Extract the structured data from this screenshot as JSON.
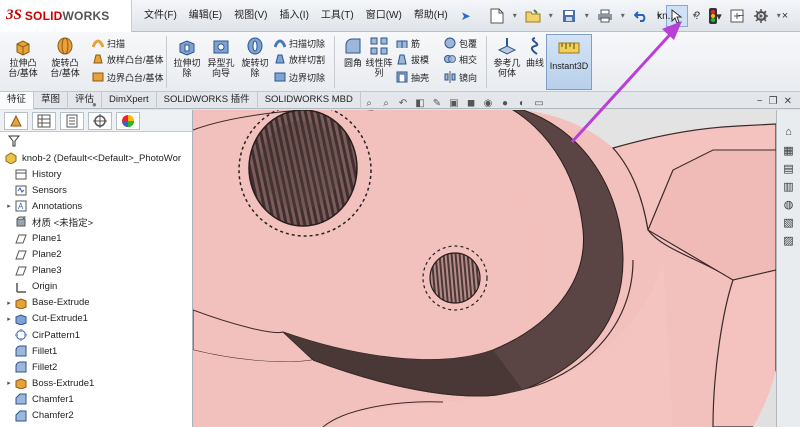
{
  "app": {
    "logo_ds": "3S",
    "logo_solid": "SOLID",
    "logo_works": "WORKS",
    "document_name": "kn..."
  },
  "menu": [
    "文件(F)",
    "编辑(E)",
    "视图(V)",
    "插入(I)",
    "工具(T)",
    "窗口(W)",
    "帮助(H)"
  ],
  "quick_access": {
    "icons": [
      "new-icon",
      "open-icon",
      "save-icon",
      "print-icon",
      "undo-icon",
      "select-icon",
      "traffic-light-icon",
      "rebuild-icon",
      "options-icon"
    ],
    "help": "?"
  },
  "window_buttons": [
    "−",
    "□",
    "×"
  ],
  "ribbon": {
    "extrude_boss": "拉伸凸台/基体",
    "revolve_boss": "旋转凸台/基体",
    "sweep": "扫描",
    "loft_boss": "放样凸台/基体",
    "boundary_boss": "边界凸台/基体",
    "extrude_cut": "拉伸切除",
    "hole_wizard": "异型孔向导",
    "revolve_cut": "旋转切除",
    "swept_cut": "扫描切除",
    "lofted_cut": "放样切割",
    "boundary_cut": "边界切除",
    "fillet": "圆角",
    "linear_pattern": "线性阵列",
    "rib": "筋",
    "draft": "拔模",
    "shell": "抽壳",
    "wrap": "包覆",
    "intersect": "相交",
    "mirror": "镜向",
    "ref_geometry": "参考几何体",
    "curves": "曲线",
    "instant3d": "Instant3D"
  },
  "tabs": [
    "特征",
    "草图",
    "评估",
    "DimXpert",
    "SOLIDWORKS 插件",
    "SOLIDWORKS MBD"
  ],
  "tree": {
    "root": "knob-2  (Default<<Default>_PhotoWor",
    "items": [
      {
        "label": "History",
        "icon": "history-icon",
        "arrow": ""
      },
      {
        "label": "Sensors",
        "icon": "sensor-icon",
        "arrow": ""
      },
      {
        "label": "Annotations",
        "icon": "annotation-icon",
        "arrow": "▸"
      },
      {
        "label": "材质 <未指定>",
        "icon": "material-icon",
        "arrow": ""
      },
      {
        "label": "Plane1",
        "icon": "plane-icon",
        "arrow": ""
      },
      {
        "label": "Plane2",
        "icon": "plane-icon",
        "arrow": ""
      },
      {
        "label": "Plane3",
        "icon": "plane-icon",
        "arrow": ""
      },
      {
        "label": "Origin",
        "icon": "origin-icon",
        "arrow": ""
      },
      {
        "label": "Base-Extrude",
        "icon": "extrude-icon",
        "arrow": "▸"
      },
      {
        "label": "Cut-Extrude1",
        "icon": "cut-extrude-icon",
        "arrow": "▸"
      },
      {
        "label": "CirPattern1",
        "icon": "circular-pattern-icon",
        "arrow": ""
      },
      {
        "label": "Fillet1",
        "icon": "fillet-icon",
        "arrow": ""
      },
      {
        "label": "Fillet2",
        "icon": "fillet-icon",
        "arrow": ""
      },
      {
        "label": "Boss-Extrude1",
        "icon": "extrude-icon",
        "arrow": "▸"
      },
      {
        "label": "Chamfer1",
        "icon": "chamfer-icon",
        "arrow": ""
      },
      {
        "label": "Chamfer2",
        "icon": "chamfer-icon",
        "arrow": ""
      }
    ]
  },
  "colors": {
    "part": "#f2bcb8",
    "part_shadow": "#d49a96",
    "part_dark": "#5a4544",
    "annotation": "#b93fd9"
  }
}
